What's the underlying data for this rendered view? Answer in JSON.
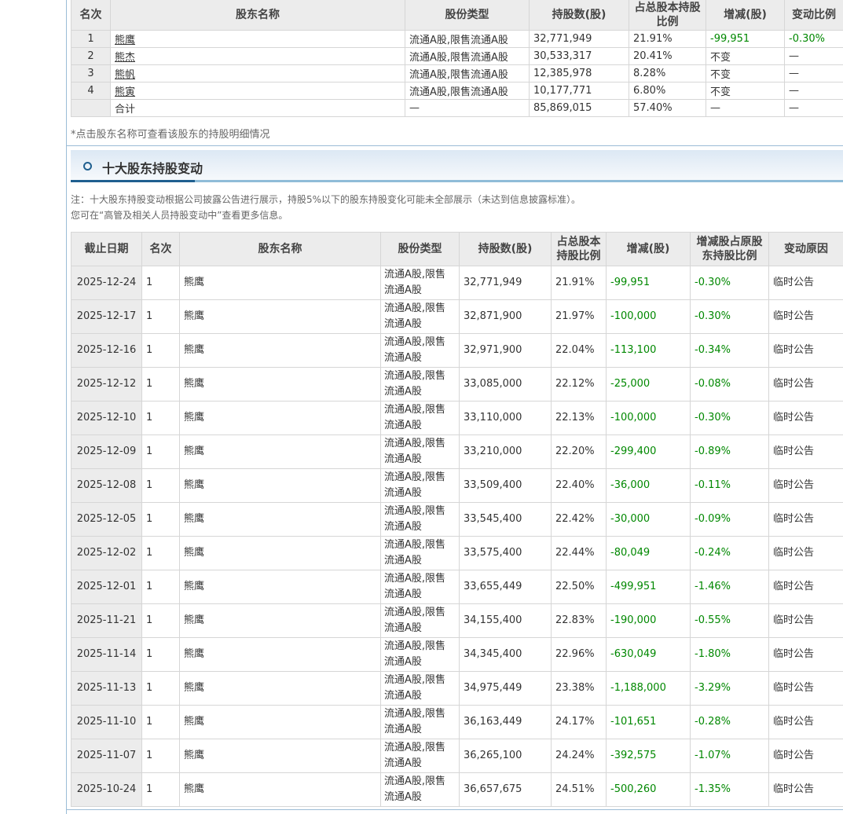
{
  "top_holders": {
    "headers": [
      "名次",
      "股东名称",
      "股份类型",
      "持股数(股)",
      "占总股本持股比例",
      "增减(股)",
      "变动比例"
    ],
    "rows": [
      {
        "rank": "1",
        "name": "熊鹰",
        "type": "流通A股,限售流通A股",
        "shares": "32,771,949",
        "pct": "21.91%",
        "change": "-99,951",
        "ratio": "-0.30%"
      },
      {
        "rank": "2",
        "name": "熊杰",
        "type": "流通A股,限售流通A股",
        "shares": "30,533,317",
        "pct": "20.41%",
        "change": "不变",
        "ratio": "—"
      },
      {
        "rank": "3",
        "name": "熊帆",
        "type": "流通A股,限售流通A股",
        "shares": "12,385,978",
        "pct": "8.28%",
        "change": "不变",
        "ratio": "—"
      },
      {
        "rank": "4",
        "name": "熊寅",
        "type": "流通A股,限售流通A股",
        "shares": "10,177,771",
        "pct": "6.80%",
        "change": "不变",
        "ratio": "—"
      }
    ],
    "total": {
      "label": "合计",
      "type": "—",
      "shares": "85,869,015",
      "pct": "57.40%",
      "change": "—",
      "ratio": "—"
    },
    "note": "*点击股东名称可查看该股东的持股明细情况"
  },
  "changes_section": {
    "title": "十大股东持股变动",
    "note_line1": "注：十大股东持股变动根据公司披露公告进行展示，持股5%以下的股东持股变化可能未全部展示（未达到信息披露标准）。",
    "note_line2": "您可在“高管及相关人员持股变动中”查看更多信息。",
    "headers": [
      "截止日期",
      "名次",
      "股东名称",
      "股份类型",
      "持股数(股)",
      "占总股本持股比例",
      "增减(股)",
      "增减股占原股东持股比例",
      "变动原因"
    ],
    "rows": [
      {
        "date": "2025-12-24",
        "rank": "1",
        "name": "熊鹰",
        "type": "流通A股,限售流通A股",
        "shares": "32,771,949",
        "pct": "21.91%",
        "change": "-99,951",
        "ratio": "-0.30%",
        "reason": "临时公告"
      },
      {
        "date": "2025-12-17",
        "rank": "1",
        "name": "熊鹰",
        "type": "流通A股,限售流通A股",
        "shares": "32,871,900",
        "pct": "21.97%",
        "change": "-100,000",
        "ratio": "-0.30%",
        "reason": "临时公告"
      },
      {
        "date": "2025-12-16",
        "rank": "1",
        "name": "熊鹰",
        "type": "流通A股,限售流通A股",
        "shares": "32,971,900",
        "pct": "22.04%",
        "change": "-113,100",
        "ratio": "-0.34%",
        "reason": "临时公告"
      },
      {
        "date": "2025-12-12",
        "rank": "1",
        "name": "熊鹰",
        "type": "流通A股,限售流通A股",
        "shares": "33,085,000",
        "pct": "22.12%",
        "change": "-25,000",
        "ratio": "-0.08%",
        "reason": "临时公告"
      },
      {
        "date": "2025-12-10",
        "rank": "1",
        "name": "熊鹰",
        "type": "流通A股,限售流通A股",
        "shares": "33,110,000",
        "pct": "22.13%",
        "change": "-100,000",
        "ratio": "-0.30%",
        "reason": "临时公告"
      },
      {
        "date": "2025-12-09",
        "rank": "1",
        "name": "熊鹰",
        "type": "流通A股,限售流通A股",
        "shares": "33,210,000",
        "pct": "22.20%",
        "change": "-299,400",
        "ratio": "-0.89%",
        "reason": "临时公告"
      },
      {
        "date": "2025-12-08",
        "rank": "1",
        "name": "熊鹰",
        "type": "流通A股,限售流通A股",
        "shares": "33,509,400",
        "pct": "22.40%",
        "change": "-36,000",
        "ratio": "-0.11%",
        "reason": "临时公告"
      },
      {
        "date": "2025-12-05",
        "rank": "1",
        "name": "熊鹰",
        "type": "流通A股,限售流通A股",
        "shares": "33,545,400",
        "pct": "22.42%",
        "change": "-30,000",
        "ratio": "-0.09%",
        "reason": "临时公告"
      },
      {
        "date": "2025-12-02",
        "rank": "1",
        "name": "熊鹰",
        "type": "流通A股,限售流通A股",
        "shares": "33,575,400",
        "pct": "22.44%",
        "change": "-80,049",
        "ratio": "-0.24%",
        "reason": "临时公告"
      },
      {
        "date": "2025-12-01",
        "rank": "1",
        "name": "熊鹰",
        "type": "流通A股,限售流通A股",
        "shares": "33,655,449",
        "pct": "22.50%",
        "change": "-499,951",
        "ratio": "-1.46%",
        "reason": "临时公告"
      },
      {
        "date": "2025-11-21",
        "rank": "1",
        "name": "熊鹰",
        "type": "流通A股,限售流通A股",
        "shares": "34,155,400",
        "pct": "22.83%",
        "change": "-190,000",
        "ratio": "-0.55%",
        "reason": "临时公告"
      },
      {
        "date": "2025-11-14",
        "rank": "1",
        "name": "熊鹰",
        "type": "流通A股,限售流通A股",
        "shares": "34,345,400",
        "pct": "22.96%",
        "change": "-630,049",
        "ratio": "-1.80%",
        "reason": "临时公告"
      },
      {
        "date": "2025-11-13",
        "rank": "1",
        "name": "熊鹰",
        "type": "流通A股,限售流通A股",
        "shares": "34,975,449",
        "pct": "23.38%",
        "change": "-1,188,000",
        "ratio": "-3.29%",
        "reason": "临时公告"
      },
      {
        "date": "2025-11-10",
        "rank": "1",
        "name": "熊鹰",
        "type": "流通A股,限售流通A股",
        "shares": "36,163,449",
        "pct": "24.17%",
        "change": "-101,651",
        "ratio": "-0.28%",
        "reason": "临时公告"
      },
      {
        "date": "2025-11-07",
        "rank": "1",
        "name": "熊鹰",
        "type": "流通A股,限售流通A股",
        "shares": "36,265,100",
        "pct": "24.24%",
        "change": "-392,575",
        "ratio": "-1.07%",
        "reason": "临时公告"
      },
      {
        "date": "2025-10-24",
        "rank": "1",
        "name": "熊鹰",
        "type": "流通A股,限售流通A股",
        "shares": "36,657,675",
        "pct": "24.51%",
        "change": "-500,260",
        "ratio": "-1.35%",
        "reason": "临时公告"
      }
    ]
  },
  "colors": {
    "decrease": "#008800",
    "accent": "#1f5f8f"
  }
}
